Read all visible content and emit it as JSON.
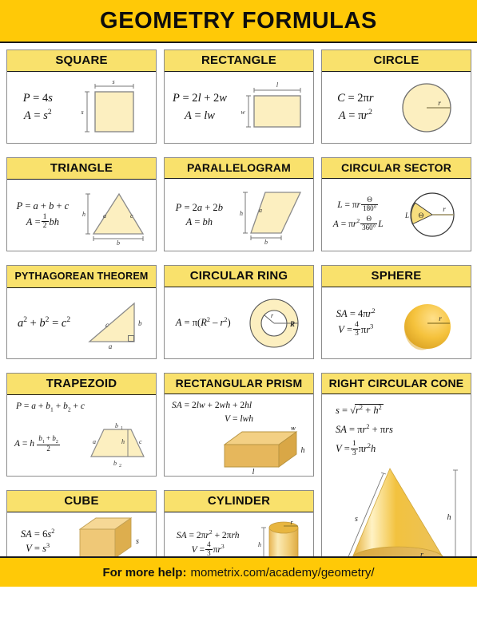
{
  "banner": {
    "title": "GEOMETRY FORMULAS",
    "bg": "#FFC907"
  },
  "footer": {
    "prefix": "For more help:",
    "url": "mometrix.com/academy/geometry/",
    "bg": "#FFC907"
  },
  "colors": {
    "banner_gold": "#FFC907",
    "header_yellow": "#F9E16C",
    "flat_shape_fill": "#FCEFC0",
    "solid_shape_fill": "#F2C14B",
    "border": "#8c8c8c",
    "text": "#111111"
  },
  "cards": [
    {
      "id": "square",
      "title": "SQUARE",
      "formulas": [
        "P = 4s",
        "A = s²"
      ],
      "figure": "square-figure",
      "labels": [
        "s",
        "s"
      ]
    },
    {
      "id": "rectangle",
      "title": "RECTANGLE",
      "formulas": [
        "P = 2l + 2w",
        "A = lw"
      ],
      "figure": "rectangle-figure",
      "labels": [
        "l",
        "w"
      ]
    },
    {
      "id": "circle",
      "title": "CIRCLE",
      "formulas": [
        "C = 2πr",
        "A = πr²"
      ],
      "figure": "circle-figure",
      "labels": [
        "r"
      ]
    },
    {
      "id": "triangle",
      "title": "TRIANGLE",
      "formulas": [
        "P = a + b + c",
        "A = ½bh"
      ],
      "figure": "triangle-figure",
      "labels": [
        "h",
        "a",
        "c",
        "b"
      ]
    },
    {
      "id": "parallelogram",
      "title": "PARALLELOGRAM",
      "formulas": [
        "P = 2a + 2b",
        "A = bh"
      ],
      "figure": "parallelogram-figure",
      "labels": [
        "h",
        "a",
        "b"
      ]
    },
    {
      "id": "circular-sector",
      "title": "CIRCULAR SECTOR",
      "formulas": [
        "L = πr θ/180°",
        "A = πr² θ/360° L"
      ],
      "figure": "circular-sector-figure",
      "labels": [
        "L",
        "θ",
        "r"
      ]
    },
    {
      "id": "pythagorean-theorem",
      "title": "PYTHAGOREAN THEOREM",
      "formulas": [
        "a² + b² = c²"
      ],
      "figure": "right-triangle-figure",
      "labels": [
        "c",
        "b",
        "a"
      ]
    },
    {
      "id": "circular-ring",
      "title": "CIRCULAR RING",
      "formulas": [
        "A = π(R² – r²)"
      ],
      "figure": "circular-ring-figure",
      "labels": [
        "r",
        "R"
      ]
    },
    {
      "id": "sphere",
      "title": "SPHERE",
      "formulas": [
        "SA = 4πr²",
        "V = 4/3 πr³"
      ],
      "figure": "sphere-figure",
      "labels": [
        "r"
      ]
    },
    {
      "id": "trapezoid",
      "title": "TRAPEZOID",
      "formulas": [
        "P = a + b₁ + b₂ + c",
        "A = h (b₁ + b₂)/2"
      ],
      "figure": "trapezoid-figure",
      "labels": [
        "b₁",
        "a",
        "h",
        "c",
        "b₂"
      ]
    },
    {
      "id": "rectangular-prism",
      "title": "RECTANGULAR PRISM",
      "formulas": [
        "SA = 2lw + 2wh + 2hl",
        "V = lwh"
      ],
      "figure": "rectangular-prism-figure",
      "labels": [
        "w",
        "h",
        "l"
      ]
    },
    {
      "id": "right-circular-cone",
      "title": "RIGHT CIRCULAR CONE",
      "formulas": [
        "s = √(r² + h²)",
        "SA = πr² + πrs",
        "V = 1/3 πr²h"
      ],
      "figure": "cone-figure",
      "labels": [
        "s",
        "h",
        "r"
      ]
    },
    {
      "id": "cube",
      "title": "CUBE",
      "formulas": [
        "SA = 6s²",
        "V = s³"
      ],
      "figure": "cube-figure",
      "labels": [
        "s"
      ]
    },
    {
      "id": "cylinder",
      "title": "CYLINDER",
      "formulas": [
        "SA = 2πr² + 2πrh",
        "V = 4/3 πr³"
      ],
      "figure": "cylinder-figure",
      "labels": [
        "r",
        "h"
      ]
    }
  ]
}
